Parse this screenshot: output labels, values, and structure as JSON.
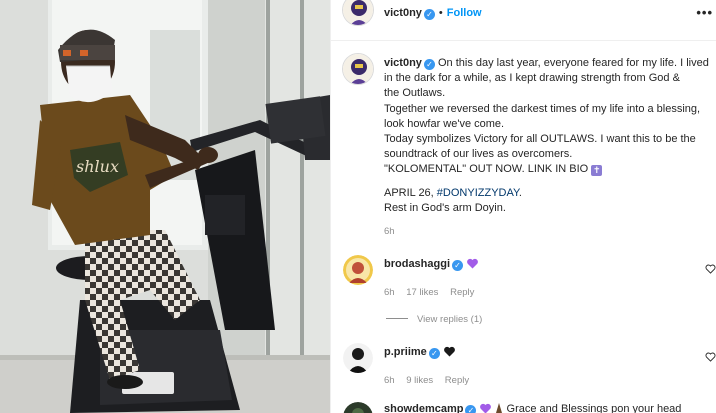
{
  "post": {
    "username": "vict0ny",
    "follow_label": "Follow",
    "separator": "•",
    "more_label": "•••",
    "caption_lines": [
      "On this day last year, everyone feared for my life. I lived",
      "in the dark for a while, as I kept drawing strength from God &",
      "the Outlaws.",
      "Together we reversed the darkest times of my life into a blessing,",
      "look howfar we've come.",
      "Today symbolizes Victory for all OUTLAWS. I want this to be the",
      "soundtrack of our lives as overcomers.",
      "\"KOLOMENTAL\" OUT NOW. LINK IN BIO"
    ],
    "date_text": "APRIL 26, ",
    "hashtag": "#DONYIZZYDAY",
    "date_suffix": ".",
    "closing_line": "Rest in God's arm Doyin.",
    "time_ago": "6h",
    "emoji_cross": "✝"
  },
  "comments": [
    {
      "username": "brodashaggi",
      "emoji": "purple-heart",
      "time": "6h",
      "likes": "17 likes",
      "reply_label": "Reply"
    },
    {
      "username": "p.priime",
      "emoji": "black-heart",
      "time": "6h",
      "likes": "9 likes",
      "reply_label": "Reply"
    },
    {
      "username": "showdemcamp",
      "emoji": "purple-heart",
      "text": "Grace and Blessings pon your head"
    }
  ],
  "view_replies_label": "View replies (1)",
  "colors": {
    "link_blue": "#0095f6",
    "hashtag": "#00376b",
    "verified": "#3897f0",
    "muted": "#8e8e8e",
    "purple_heart": "#a25ce8"
  },
  "icons": [
    "verified-badge-icon",
    "more-options-icon",
    "heart-icon",
    "purple-heart-icon",
    "black-heart-icon",
    "latin-cross-icon"
  ]
}
